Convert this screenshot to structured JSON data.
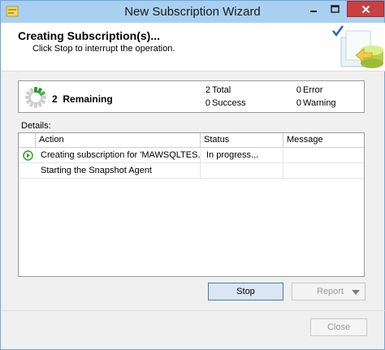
{
  "window": {
    "title": "New Subscription Wizard"
  },
  "header": {
    "title": "Creating Subscription(s)...",
    "subtitle": "Click Stop to interrupt the operation."
  },
  "summary": {
    "remaining_count": "2",
    "remaining_label": "Remaining",
    "total_count": "2",
    "total_label": "Total",
    "success_count": "0",
    "success_label": "Success",
    "error_count": "0",
    "error_label": "Error",
    "warning_count": "0",
    "warning_label": "Warning"
  },
  "details": {
    "label": "Details:",
    "columns": [
      "Action",
      "Status",
      "Message"
    ],
    "rows": [
      {
        "action": "Creating subscription for 'MAWSQLTES...",
        "status": "In progress...",
        "message": "",
        "icon": "in-progress-icon"
      },
      {
        "action": "Starting the Snapshot Agent",
        "status": "",
        "message": "",
        "icon": ""
      }
    ]
  },
  "buttons": {
    "stop": "Stop",
    "report": "Report",
    "close": "Close"
  },
  "colors": {
    "titlebar": "#a9d0f0",
    "close_button": "#c94040",
    "progress_green": "#2aa12a"
  }
}
